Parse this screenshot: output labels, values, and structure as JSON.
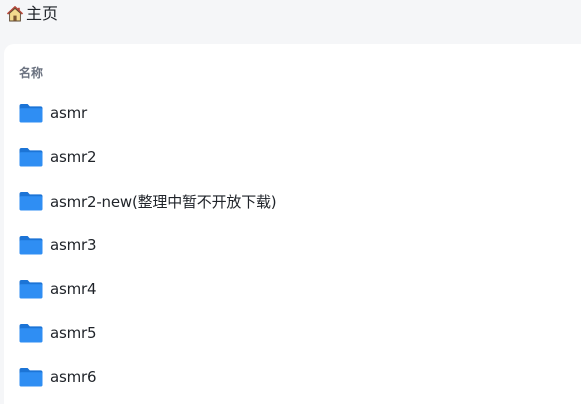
{
  "breadcrumb": {
    "icon": "home-icon",
    "label": "主页"
  },
  "list": {
    "header": "名称",
    "folder_color": "#2f8ef3",
    "folder_dark": "#1c74d6",
    "items": [
      {
        "name": "asmr",
        "icon": "folder-icon"
      },
      {
        "name": "asmr2",
        "icon": "folder-icon"
      },
      {
        "name": "asmr2-new(整理中暂不开放下载)",
        "icon": "folder-icon"
      },
      {
        "name": "asmr3",
        "icon": "folder-icon"
      },
      {
        "name": "asmr4",
        "icon": "folder-icon"
      },
      {
        "name": "asmr5",
        "icon": "folder-icon"
      },
      {
        "name": "asmr6",
        "icon": "folder-icon"
      }
    ]
  }
}
